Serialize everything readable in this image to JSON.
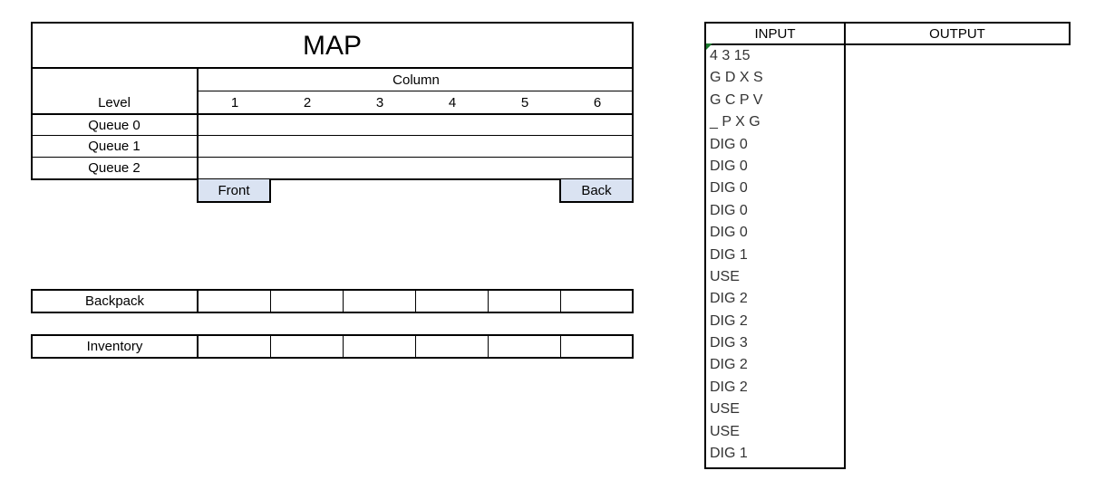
{
  "map": {
    "title": "MAP",
    "column_header": "Column",
    "level_label": "Level",
    "columns": [
      "1",
      "2",
      "3",
      "4",
      "5",
      "6"
    ],
    "queues": [
      "Queue 0",
      "Queue 1",
      "Queue 2"
    ],
    "front_label": "Front",
    "back_label": "Back"
  },
  "backpack": {
    "label": "Backpack"
  },
  "inventory": {
    "label": "Inventory"
  },
  "io": {
    "input_header": "INPUT",
    "output_header": "OUTPUT",
    "input_lines": [
      "4 3 15",
      "G D X S",
      "G C P V",
      "_ P X G",
      "DIG 0",
      "DIG 0",
      "DIG 0",
      "DIG 0",
      "DIG 0",
      "DIG 1",
      "USE",
      "DIG 2",
      "DIG 2",
      "DIG 3",
      "DIG 2",
      "DIG 2",
      "USE",
      "USE",
      "DIG 1"
    ]
  },
  "colors": {
    "highlight": "#dae3f2",
    "grid": "#000000",
    "corner_mark": "#1a7a2e"
  }
}
